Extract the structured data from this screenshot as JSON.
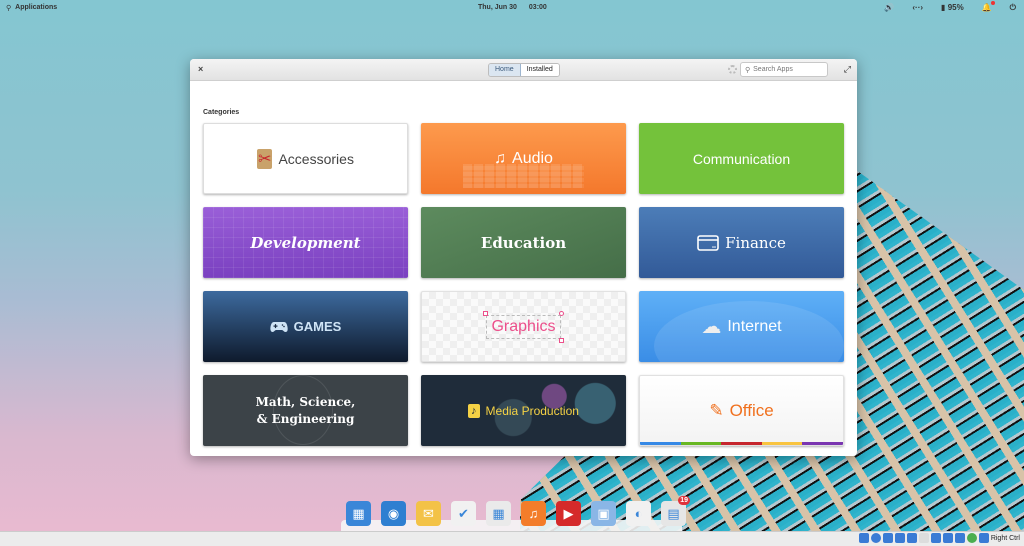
{
  "topbar": {
    "applications_label": "Applications",
    "date": "Thu, Jun 30",
    "time": "03:00",
    "battery_percent": "95%",
    "icons": [
      "search-icon",
      "volume-icon",
      "network-icon",
      "battery-icon",
      "notifications-icon",
      "power-icon"
    ]
  },
  "window": {
    "close_glyph": "×",
    "tabs": [
      {
        "label": "Home",
        "active": true
      },
      {
        "label": "Installed",
        "active": false
      }
    ],
    "search_placeholder": "Search Apps",
    "maximize_glyph": "⤢",
    "section_title": "Categories",
    "categories": [
      {
        "label": "Accessories",
        "icon": "scissors-icon",
        "glyph": "✂"
      },
      {
        "label": "Audio",
        "icon": "music-note-icon",
        "glyph": "♫"
      },
      {
        "label": "Communication",
        "icon": "",
        "glyph": ""
      },
      {
        "label": "Development",
        "icon": "",
        "glyph": ""
      },
      {
        "label": "Education",
        "icon": "",
        "glyph": ""
      },
      {
        "label": "Finance",
        "icon": "credit-card-icon",
        "glyph": ""
      },
      {
        "label": "GAMES",
        "icon": "gamepad-icon",
        "glyph": "🎮"
      },
      {
        "label": "Graphics",
        "icon": "",
        "glyph": ""
      },
      {
        "label": "Internet",
        "icon": "cloud-icon",
        "glyph": "☁"
      },
      {
        "label_line1": "Math, Science,",
        "label_line2": "& Engineering"
      },
      {
        "label": "Media Production",
        "icon": "music-file-icon",
        "glyph": "♪"
      },
      {
        "label": "Office",
        "icon": "pencil-icon",
        "glyph": "✎"
      }
    ],
    "office_stripe_colors": [
      "#3689e6",
      "#68b723",
      "#c6262e",
      "#f9c440",
      "#7a36b1"
    ]
  },
  "dock": {
    "items": [
      {
        "name": "multitasking-view",
        "color": "#3a86d8",
        "glyph": "▦"
      },
      {
        "name": "web-browser",
        "color": "#2f7fd1",
        "glyph": "◉"
      },
      {
        "name": "mail",
        "color": "#f3c247",
        "glyph": "✉"
      },
      {
        "name": "tasks",
        "color": "#f1f1f1",
        "glyph": "✔"
      },
      {
        "name": "calendar",
        "color": "#eaeaea",
        "glyph": "▦"
      },
      {
        "name": "music",
        "color": "#f37d2a",
        "glyph": "♫"
      },
      {
        "name": "videos",
        "color": "#d52a2a",
        "glyph": "▶"
      },
      {
        "name": "photos",
        "color": "#8ab6e6",
        "glyph": "▣"
      },
      {
        "name": "system-settings",
        "color": "#f1f1f1",
        "glyph": "◐"
      },
      {
        "name": "appcenter",
        "color": "#e6e6e6",
        "glyph": "▤",
        "badge": "19"
      }
    ]
  },
  "vbox": {
    "host_key_label": "Right Ctrl"
  }
}
